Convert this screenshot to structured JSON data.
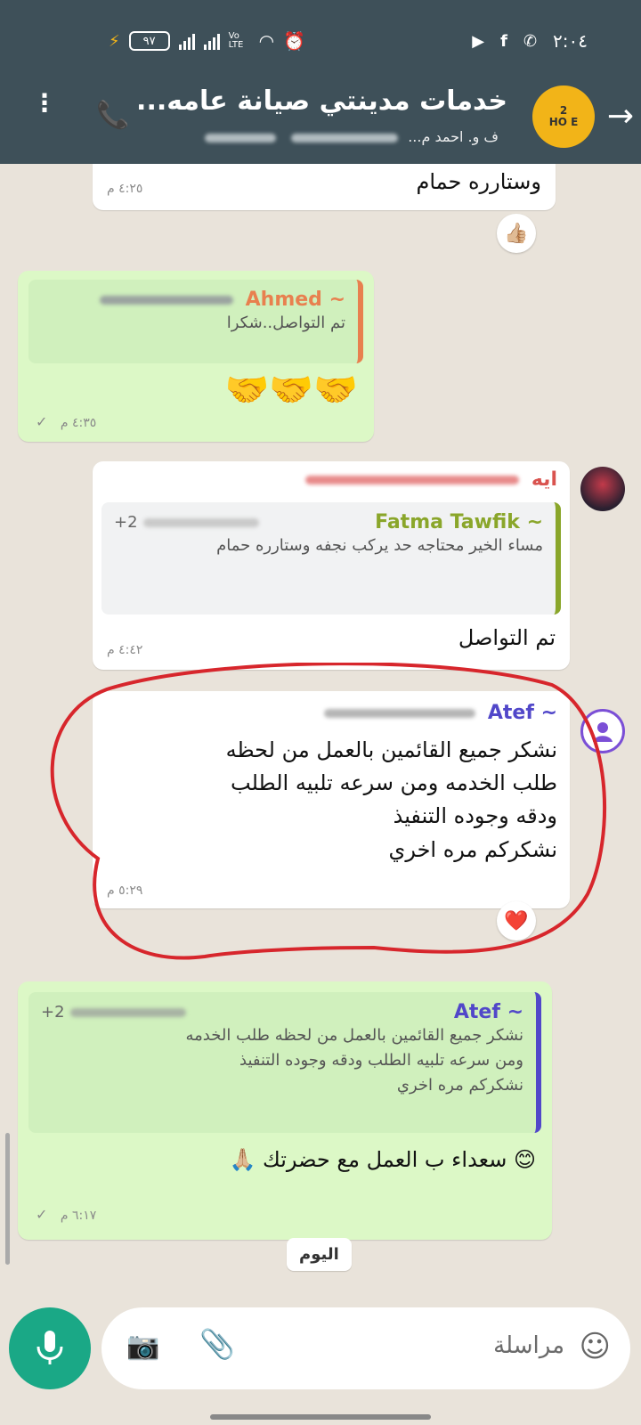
{
  "status_bar": {
    "battery": "٩٧",
    "volte": "Vo LTE",
    "clock": "٢:٠٤"
  },
  "header": {
    "title": "خدمات مدينتي صيانة عامه...",
    "subtitle_end": "ف و. احمد م...",
    "avatar_text_top": "2",
    "avatar_text_bottom": "HO E"
  },
  "messages": [
    {
      "id": "m1",
      "text": "وستارره حمام",
      "time": "٤:٢٥ م",
      "reaction": "👍🏼"
    },
    {
      "id": "m2",
      "quote_name": "~ Ahmed",
      "quote_text": "تم التواصل..شكرا",
      "body": "🤝🤝🤝",
      "time": "٤:٣٥ م",
      "status": "✓"
    },
    {
      "id": "m3",
      "sender": "ايه",
      "quote_name": "~ Fatma Tawfik",
      "quote_phone": "+2",
      "quote_text": "مساء الخير محتاجه حد يركب نجفه وستارره حمام",
      "text": "تم التواصل",
      "time": "٤:٤٢ م"
    },
    {
      "id": "m4",
      "sender": "~ Atef",
      "lines": [
        "نشكر جميع القائمين بالعمل  من لحظه",
        "طلب الخدمه ومن سرعه تلبيه  الطلب",
        "ودقه وجوده التنفيذ",
        "نشكركم مره اخري"
      ],
      "time": "٥:٢٩ م",
      "reaction": "❤️"
    },
    {
      "id": "m5",
      "quote_name": "~ Atef",
      "quote_phone": "+2",
      "quote_lines": [
        "نشكر جميع القائمين بالعمل  من لحظه طلب الخدمه",
        "ومن سرعه تلبيه  الطلب ودقه وجوده التنفيذ",
        "نشكركم مره اخري"
      ],
      "text": "😊 سعداء ب العمل مع حضرتك 🙏🏼",
      "time": "٦:١٧ م",
      "status": "✓"
    }
  ],
  "date_chip": "اليوم",
  "input": {
    "placeholder": "مراسلة"
  },
  "colors": {
    "header": "#3e5059",
    "chat_bg": "#e9e3da",
    "outgoing": "#dcf8c6",
    "ahmed": "#e8804f",
    "fatma": "#8aa62a",
    "atef": "#5147c9",
    "aya": "#d9534f",
    "annotation": "#d7262c",
    "mic": "#1aa886"
  }
}
